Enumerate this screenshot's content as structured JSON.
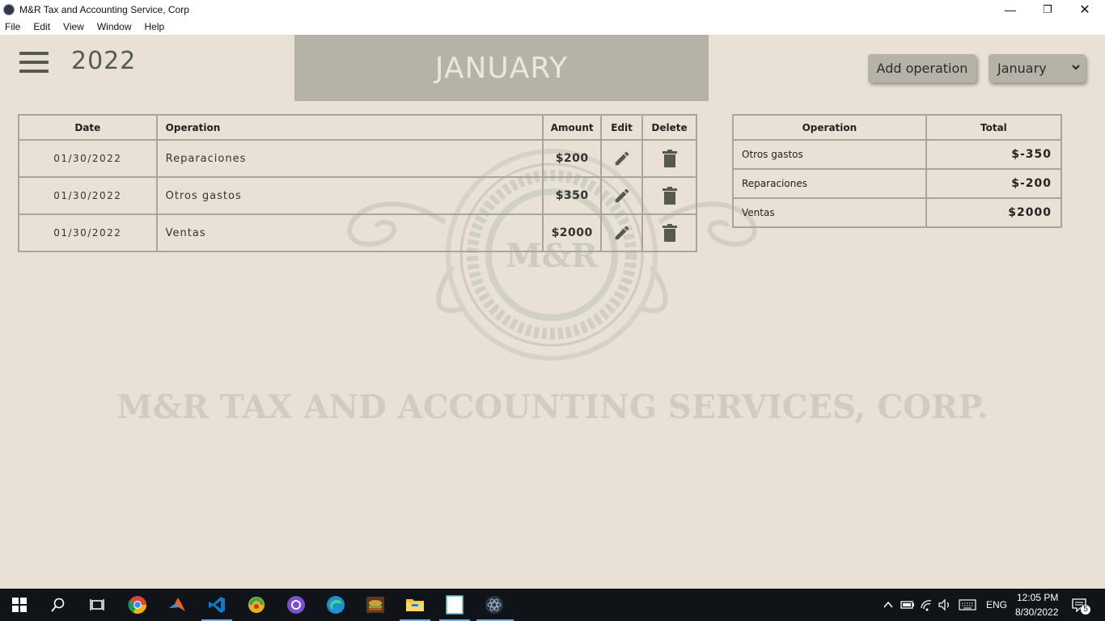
{
  "window": {
    "title": "M&R Tax and Accounting Service, Corp",
    "minimize_glyph": "—",
    "maximize_glyph": "❐",
    "close_glyph": "✕"
  },
  "menu": [
    "File",
    "Edit",
    "View",
    "Window",
    "Help"
  ],
  "header": {
    "year": "2022",
    "month_banner": "JANUARY",
    "add_button": "Add operation",
    "month_select": "January"
  },
  "operations": {
    "columns": [
      "Date",
      "Operation",
      "Amount",
      "Edit",
      "Delete"
    ],
    "rows": [
      {
        "date": "01/30/2022",
        "operation": "Reparaciones",
        "amount": "$200",
        "type": "expense"
      },
      {
        "date": "01/30/2022",
        "operation": "Otros gastos",
        "amount": "$350",
        "type": "expense"
      },
      {
        "date": "01/30/2022",
        "operation": "Ventas",
        "amount": "$2000",
        "type": "income"
      }
    ]
  },
  "totals": {
    "columns": [
      "Operation",
      "Total"
    ],
    "rows": [
      {
        "operation": "Otros gastos",
        "total": "$-350"
      },
      {
        "operation": "Reparaciones",
        "total": "$-200"
      },
      {
        "operation": "Ventas",
        "total": "$2000"
      }
    ]
  },
  "watermark": {
    "seal_text": "M&R",
    "company_text": "M&R TAX AND ACCOUNTING SERVICES, CORP."
  },
  "colors": {
    "background": "#e9e1d6",
    "banner": "#b5b3a7",
    "expense": "#e8141c",
    "income": "#0f8a14",
    "icon": "#55594f"
  },
  "taskbar": {
    "apps": [
      "start-icon",
      "search-icon",
      "task-view-icon",
      "chrome-icon",
      "matlab-icon",
      "vscode-icon",
      "codeblocks-icon",
      "github-desktop-icon",
      "edge-icon",
      "game-icon",
      "file-explorer-icon",
      "notepad-icon",
      "electron-app-icon"
    ],
    "language": "ENG",
    "time": "12:05 PM",
    "date": "8/30/2022",
    "notification_count": "5"
  }
}
